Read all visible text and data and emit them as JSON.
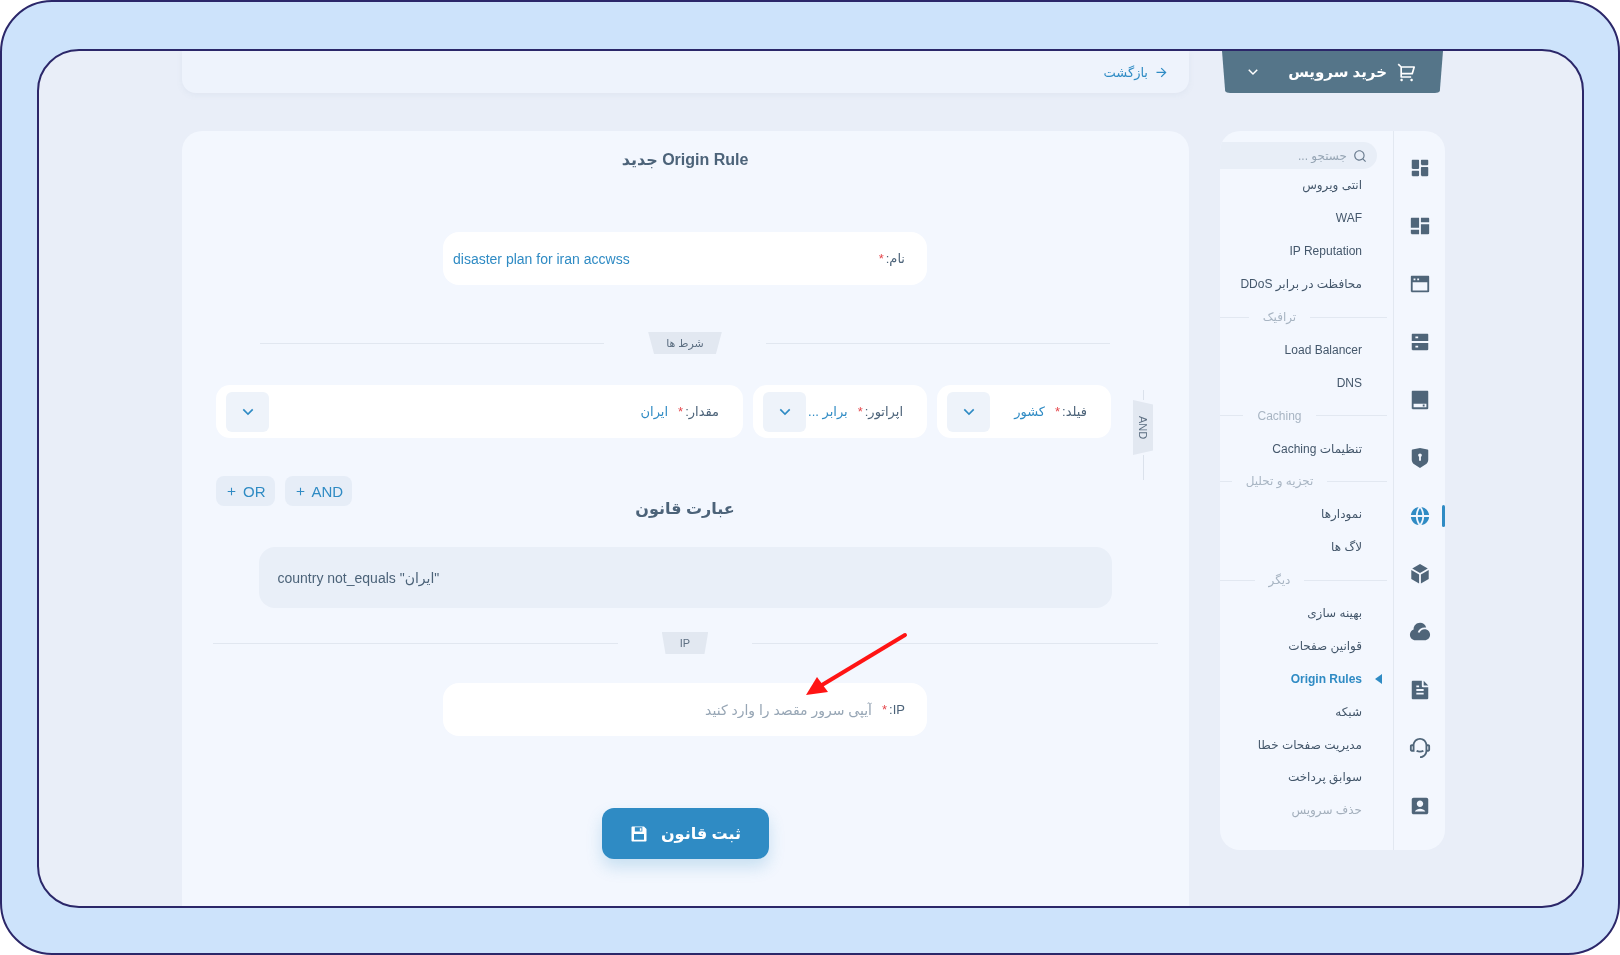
{
  "top_bar": {
    "back_link": "بازگشت",
    "buy_button": "خرید سرویس"
  },
  "sidebar": {
    "rail": [
      {
        "selected": false
      },
      {
        "selected": false
      },
      {
        "selected": false
      },
      {
        "selected": false
      },
      {
        "selected": false
      },
      {
        "selected": false
      },
      {
        "selected": true
      },
      {
        "selected": false
      },
      {
        "selected": false
      },
      {
        "selected": false
      },
      {
        "selected": false
      },
      {
        "selected": false
      }
    ],
    "search": {
      "placeholder": "جستجو ..."
    },
    "items": [
      {
        "kind": "link",
        "label": "انتی ویروس",
        "selected": false,
        "disabled": false
      },
      {
        "kind": "link",
        "label": "WAF",
        "selected": false,
        "disabled": false
      },
      {
        "kind": "link",
        "label": "IP Reputation",
        "selected": false,
        "disabled": false
      },
      {
        "kind": "link",
        "label": "محافظت در برابر DDoS",
        "selected": false,
        "disabled": false
      },
      {
        "kind": "section",
        "label": "ترافیک"
      },
      {
        "kind": "link",
        "label": "Load Balancer",
        "selected": false,
        "disabled": false
      },
      {
        "kind": "link",
        "label": "DNS",
        "selected": false,
        "disabled": false
      },
      {
        "kind": "section",
        "label": "Caching"
      },
      {
        "kind": "link",
        "label": "تنظیمات Caching",
        "selected": false,
        "disabled": false
      },
      {
        "kind": "section",
        "label": "تجزیه و تحلیل"
      },
      {
        "kind": "link",
        "label": "نمودارها",
        "selected": false,
        "disabled": false
      },
      {
        "kind": "link",
        "label": "لاگ ها",
        "selected": false,
        "disabled": false
      },
      {
        "kind": "section",
        "label": "دیگر"
      },
      {
        "kind": "link",
        "label": "بهینه سازی",
        "selected": false,
        "disabled": false
      },
      {
        "kind": "link",
        "label": "قوانین صفحات",
        "selected": false,
        "disabled": false
      },
      {
        "kind": "link",
        "label": "Origin Rules",
        "selected": true,
        "disabled": false
      },
      {
        "kind": "link",
        "label": "شبکه",
        "selected": false,
        "disabled": false
      },
      {
        "kind": "link",
        "label": "مدیریت صفحات خطا",
        "selected": false,
        "disabled": false
      },
      {
        "kind": "link",
        "label": "سوابق پرداخت",
        "selected": false,
        "disabled": false
      },
      {
        "kind": "link",
        "label": "حذف سرویس",
        "selected": false,
        "disabled": true
      }
    ]
  },
  "form": {
    "title": "Origin Rule جدید",
    "name_field": {
      "label": "نام:",
      "required_mark": "*",
      "value": "disaster plan for iran accwss"
    },
    "conditions_label": "شرط ها",
    "conditions": {
      "joiner": "AND",
      "fields": [
        {
          "label": "فیلد:",
          "required_mark": "*",
          "value": "کشور"
        },
        {
          "label": "اپراتور:",
          "required_mark": "*",
          "value": "برابر ..."
        },
        {
          "label": "مقدار:",
          "required_mark": "*",
          "value": "ایران"
        }
      ]
    },
    "add_buttons": [
      {
        "label": "AND"
      },
      {
        "label": "OR"
      }
    ],
    "expression_title": "عبارت قانون",
    "expression": "country not_equals \"ایران\"",
    "ip_label": "IP",
    "ip_field": {
      "label": "IP:",
      "required_mark": "*",
      "placeholder": "آیپی سرور مقصد را وارد کنید"
    },
    "submit_button": "ثبت قانون"
  }
}
